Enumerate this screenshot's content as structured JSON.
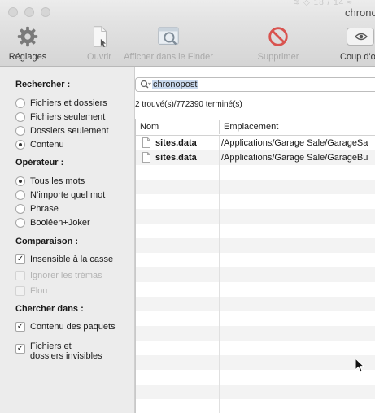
{
  "window": {
    "title": "chrono",
    "ghost_text": "≋ ◇ 18 / 14 ≈"
  },
  "toolbar": {
    "items": [
      {
        "label": "Réglages",
        "icon": "gear-icon",
        "enabled": true
      },
      {
        "label": "Ouvrir",
        "icon": "document-icon",
        "enabled": false
      },
      {
        "label": "Afficher dans le Finder",
        "icon": "finder-magnify-icon",
        "enabled": false
      },
      {
        "label": "Supprimer",
        "icon": "prohibited-icon",
        "enabled": false
      },
      {
        "label": "Coup d'œ",
        "icon": "eye-icon",
        "enabled": true
      }
    ]
  },
  "search": {
    "value": "chronopost"
  },
  "status": "2 trouvé(s)/772390 terminé(s)",
  "panel": {
    "rechercher": {
      "title": "Rechercher :",
      "options": [
        "Fichiers et dossiers",
        "Fichiers seulement",
        "Dossiers seulement",
        "Contenu"
      ],
      "selected": "Contenu"
    },
    "operateur": {
      "title": "Opérateur :",
      "options": [
        "Tous les mots",
        "N’importe quel mot",
        "Phrase",
        "Booléen+Joker"
      ],
      "selected": "Tous les mots"
    },
    "comparaison": {
      "title": "Comparaison :",
      "options": [
        {
          "label": "Insensible à la casse",
          "checked": true,
          "enabled": true
        },
        {
          "label": "Ignorer les trémas",
          "checked": false,
          "enabled": false
        },
        {
          "label": "Flou",
          "checked": false,
          "enabled": false
        }
      ]
    },
    "chercher_dans": {
      "title": "Chercher dans :",
      "options": [
        {
          "label": "Contenu des paquets",
          "checked": true
        },
        {
          "label_line1": "Fichiers et",
          "label_line2": "dossiers invisibles",
          "checked": true
        }
      ]
    }
  },
  "table": {
    "columns": [
      "Nom",
      "Emplacement"
    ],
    "rows": [
      {
        "name": "sites.data",
        "path": "/Applications/Garage Sale/GarageSa"
      },
      {
        "name": "sites.data",
        "path": "/Applications/Garage Sale/GarageBu"
      }
    ]
  },
  "colors": {
    "prohibited": "#d9534f",
    "selection": "#c9d9ee",
    "alt_row": "#f3f3f3"
  }
}
